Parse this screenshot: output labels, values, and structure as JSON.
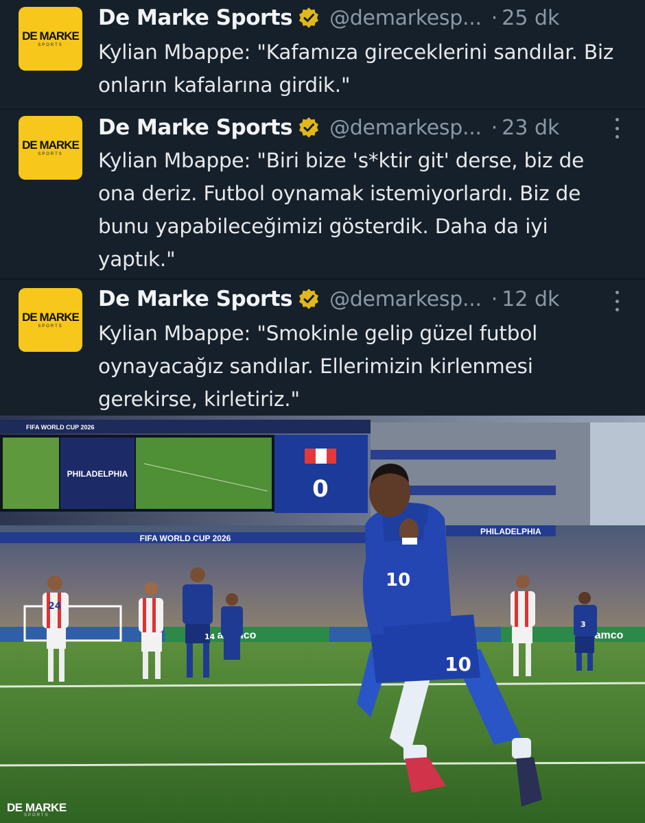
{
  "tweets": [
    {
      "account_name": "De Marke Sports",
      "handle": "@demarkesp...",
      "separator": "·",
      "time": "25 dk",
      "text": "Kylian Mbappe: \"Kafamıza gireceklerini sandılar. Biz onların kafalarına girdik.\"",
      "avatar": {
        "line1": "DE MARKE",
        "line2": "SPORTS"
      },
      "verified_icon": "verified-badge-icon",
      "more_icon": "more-options-icon"
    },
    {
      "account_name": "De Marke Sports",
      "handle": "@demarkesp...",
      "separator": "·",
      "time": "23 dk",
      "text": "Kylian Mbappe: \"Biri bize 's*ktir git' derse, biz de ona deriz. Futbol oynamak istemiyorlardı. Biz de bunu yapabileceğimizi gösterdik. Daha da iyi yaptık.\"",
      "avatar": {
        "line1": "DE MARKE",
        "line2": "SPORTS"
      },
      "verified_icon": "verified-badge-icon",
      "more_icon": "more-options-icon"
    },
    {
      "account_name": "De Marke Sports",
      "handle": "@demarkesp...",
      "separator": "·",
      "time": "12 dk",
      "text": "Kylian Mbappe: \"Smokinle gelip güzel futbol oynayacağız sandılar. Ellerimizin kirlenmesi gerekirse, kirletiriz.\"",
      "avatar": {
        "line1": "DE MARKE",
        "line2": "SPORTS"
      },
      "verified_icon": "verified-badge-icon",
      "more_icon": "more-options-icon"
    }
  ],
  "photo": {
    "banner_left": "FIFA WORLD CUP 2026",
    "banner_center": "FIFA WORLD CUP 2026",
    "city_screen": "PHILADELPHIA",
    "city_banner": "PHILADELPHIA",
    "sponsor": "aramco",
    "player_number_main": "10",
    "player_number_left": "24",
    "player_number_mid": "14",
    "player_number_right": "3",
    "scoreboard_digit": "0",
    "watermark": {
      "line1": "DE MARKE",
      "line2": "SPORTS"
    }
  },
  "colors": {
    "background": "#15202b",
    "text": "#e7e9ea",
    "muted": "#8b98a5",
    "avatar": "#f7c81b",
    "verified_gold": "#e2b719",
    "france_blue": "#1e3a8f",
    "pitch": "#3f7a2e"
  }
}
